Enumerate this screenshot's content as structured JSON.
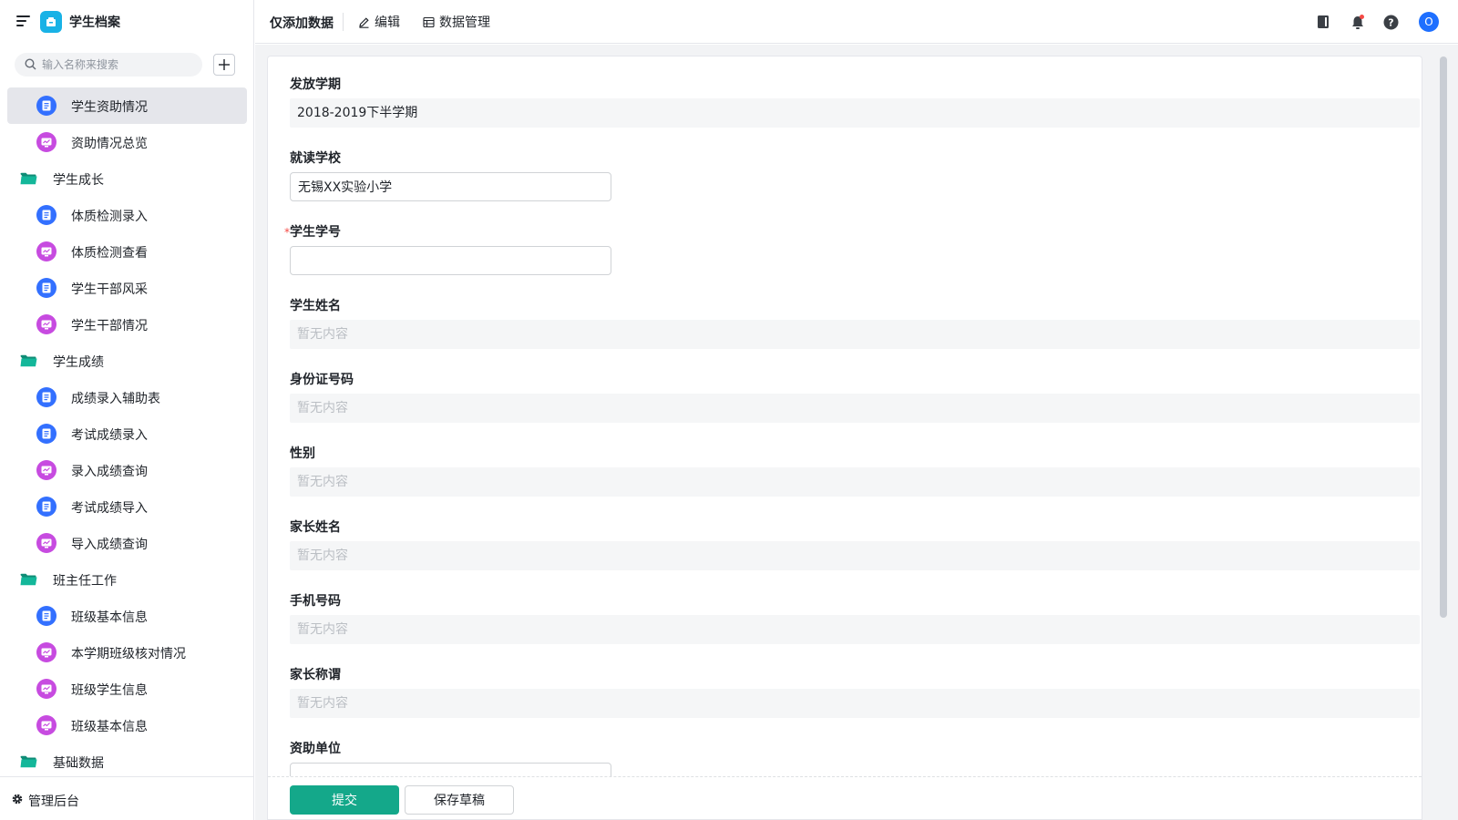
{
  "app": {
    "title": "学生档案"
  },
  "search": {
    "placeholder": "输入名称来搜索"
  },
  "sidebar": {
    "items": [
      {
        "type": "form",
        "label": "学生资助情况",
        "active": true
      },
      {
        "type": "report",
        "label": "资助情况总览"
      },
      {
        "type": "folder",
        "label": "学生成长"
      },
      {
        "type": "form",
        "label": "体质检测录入"
      },
      {
        "type": "report",
        "label": "体质检测查看"
      },
      {
        "type": "form",
        "label": "学生干部风采"
      },
      {
        "type": "report",
        "label": "学生干部情况"
      },
      {
        "type": "folder",
        "label": "学生成绩"
      },
      {
        "type": "form",
        "label": "成绩录入辅助表"
      },
      {
        "type": "form",
        "label": "考试成绩录入"
      },
      {
        "type": "report",
        "label": "录入成绩查询"
      },
      {
        "type": "form",
        "label": "考试成绩导入"
      },
      {
        "type": "report",
        "label": "导入成绩查询"
      },
      {
        "type": "folder",
        "label": "班主任工作"
      },
      {
        "type": "form",
        "label": "班级基本信息"
      },
      {
        "type": "report",
        "label": "本学期班级核对情况"
      },
      {
        "type": "report",
        "label": "班级学生信息"
      },
      {
        "type": "report",
        "label": "班级基本信息"
      },
      {
        "type": "folder",
        "label": "基础数据"
      }
    ],
    "footer_label": "管理后台"
  },
  "toolbar": {
    "mode_label": "仅添加数据",
    "edit_label": "编辑",
    "data_manage_label": "数据管理",
    "avatar_text": "O"
  },
  "form": {
    "semester": {
      "label": "发放学期",
      "value": "2018-2019下半学期"
    },
    "school": {
      "label": "就读学校",
      "value": "无锡XX实验小学"
    },
    "student_id": {
      "label": "学生学号",
      "required_mark": "*",
      "value": ""
    },
    "student_name": {
      "label": "学生姓名",
      "value": "暂无内容"
    },
    "id_card": {
      "label": "身份证号码",
      "value": "暂无内容"
    },
    "gender": {
      "label": "性别",
      "value": "暂无内容"
    },
    "parent_name": {
      "label": "家长姓名",
      "value": "暂无内容"
    },
    "phone": {
      "label": "手机号码",
      "value": "暂无内容"
    },
    "parent_relation": {
      "label": "家长称谓",
      "value": "暂无内容"
    },
    "sponsor": {
      "label": "资助单位",
      "value": ""
    }
  },
  "actions": {
    "submit_label": "提交",
    "draft_label": "保存草稿"
  },
  "colors": {
    "primary": "#14a88a",
    "form_icon": "#3370ff",
    "report_icon": "#c74be0",
    "folder": "#14b79a",
    "avatar": "#1e6fff"
  }
}
